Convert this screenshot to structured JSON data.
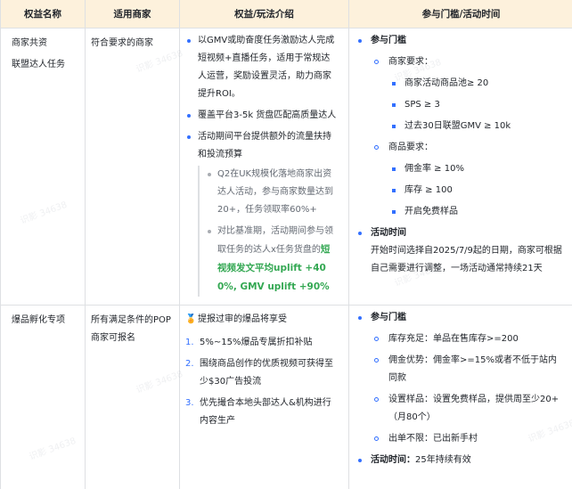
{
  "header": {
    "col1": "权益名称",
    "col2": "适用商家",
    "col3": "权益/玩法介绍",
    "col4": "参与门槛/活动时间"
  },
  "rows": [
    {
      "name_line1": "商家共资",
      "name_line2": "联盟达人任务",
      "merchants": "符合要求的商家",
      "benefits": [
        "以GMV或助奋度任务激励达人完成短视频+直播任务，适用于常规达人运营，奖励设置灵活，助力商家提升ROI。",
        "覆盖平台3-5k 货盘匹配高质量达人",
        "活动期间平台提供额外的流量扶持和投流预算"
      ],
      "sub_benefits": {
        "item1": "Q2在UK规模化落地商家出资达人活动，参与商家数量达到20+，任务领取率60%+",
        "item2_prefix": "对比基准期，活动期间参与领取任务的达人x任务货盘的",
        "item2_highlight": "短视频发文平均uplift +400%, GMV uplift +90%"
      },
      "threshold_title": "参与门槛",
      "merchant_req_title": "商家要求：",
      "merchant_reqs": [
        "商家活动商品池≥ 20",
        "SPS ≥ 3",
        "过去30日联盟GMV ≥ 10k"
      ],
      "product_req_title": "商品要求：",
      "product_reqs": [
        "佣金率 ≥ 10%",
        "库存 ≥ 100",
        "开启免费样品"
      ],
      "time_title": "活动时间",
      "time_text": "开始时间选择自2025/7/9起的日期，商家可根据自己需要进行调整，一场活动通常持续21天"
    },
    {
      "name": "爆品孵化专项",
      "merchants": "所有满足条件的POP 商家可报名",
      "benefit_intro": "提报过审的爆品将享受",
      "numbered": [
        "5%~15%爆品专属折扣补贴",
        "围绕商品创作的优质视频可获得至少$30广告投流",
        "优先撮合本地头部达人&机构进行内容生产"
      ],
      "threshold_title": "参与门槛",
      "reqs": [
        "库存充足：单品在售库存>=200",
        "佣金优势：佣金率>=15%或者不低于站内同款",
        "设置样品：设置免费样品，提供周至少20+（月80个）",
        "出单不限：已出新手村"
      ],
      "time_label": "活动时间：",
      "time_text": "25年持续有效"
    }
  ],
  "watermark": "识影 34638",
  "colors": {
    "header_bg": "#fdf1dc",
    "accent_blue": "#3370ff",
    "highlight_green": "#34a853",
    "border": "#dee0e3"
  },
  "icons": {
    "medal": "medal-icon"
  }
}
